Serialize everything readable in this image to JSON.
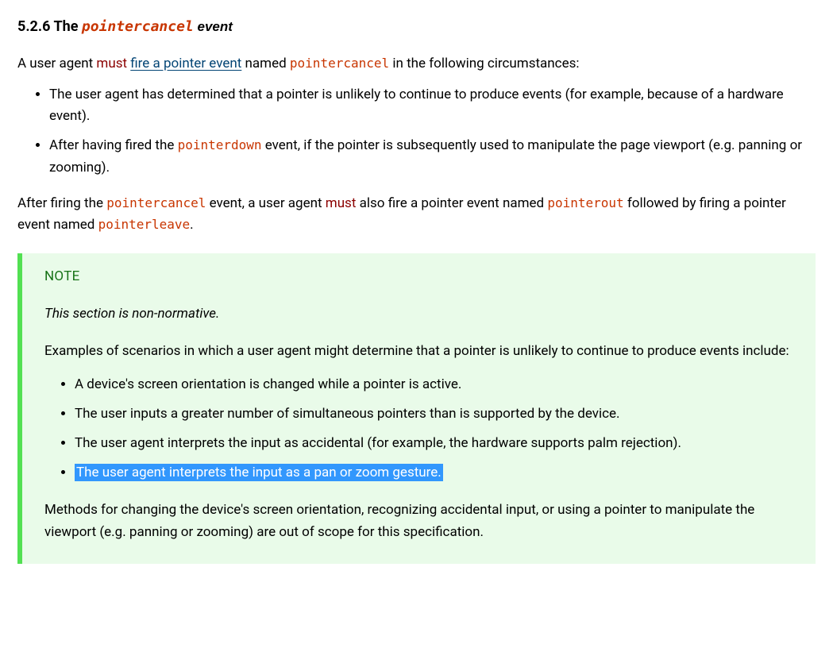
{
  "heading": {
    "number": "5.2.6",
    "prefix": "The ",
    "code": "pointercancel",
    "suffix": " event"
  },
  "intro": {
    "p1_a": "A user agent ",
    "must": "must",
    "p1_b": " ",
    "link": "fire a pointer event",
    "p1_c": " named ",
    "code1": "pointercancel",
    "p1_d": " in the following circumstances:"
  },
  "circumstances": [
    "The user agent has determined that a pointer is unlikely to continue to produce events (for example, because of a hardware event).",
    "After having fired the pointerdown event, if the pointer is subsequently used to manipulate the page viewport (e.g. panning or zooming)."
  ],
  "li2": {
    "a": "After having fired the ",
    "code": "pointerdown",
    "b": " event, if the pointer is subsequently used to manipulate the page viewport (e.g. panning or zooming)."
  },
  "after": {
    "a": "After firing the ",
    "code1": "pointercancel",
    "b": " event, a user agent ",
    "must": "must",
    "c": " also fire a pointer event named ",
    "code2": "pointerout",
    "d": " followed by firing a pointer event named ",
    "code3": "pointerleave",
    "e": "."
  },
  "note": {
    "title": "NOTE",
    "nonnorm": "This section is non-normative.",
    "intro": "Examples of scenarios in which a user agent might determine that a pointer is unlikely to continue to produce events include:",
    "items": [
      "A device's screen orientation is changed while a pointer is active.",
      "The user inputs a greater number of simultaneous pointers than is supported by the device.",
      "The user agent interprets the input as accidental (for example, the hardware supports palm rejection).",
      "The user agent interprets the input as a pan or zoom gesture."
    ],
    "outro": "Methods for changing the device's screen orientation, recognizing accidental input, or using a pointer to manipulate the viewport (e.g. panning or zooming) are out of scope for this specification."
  }
}
